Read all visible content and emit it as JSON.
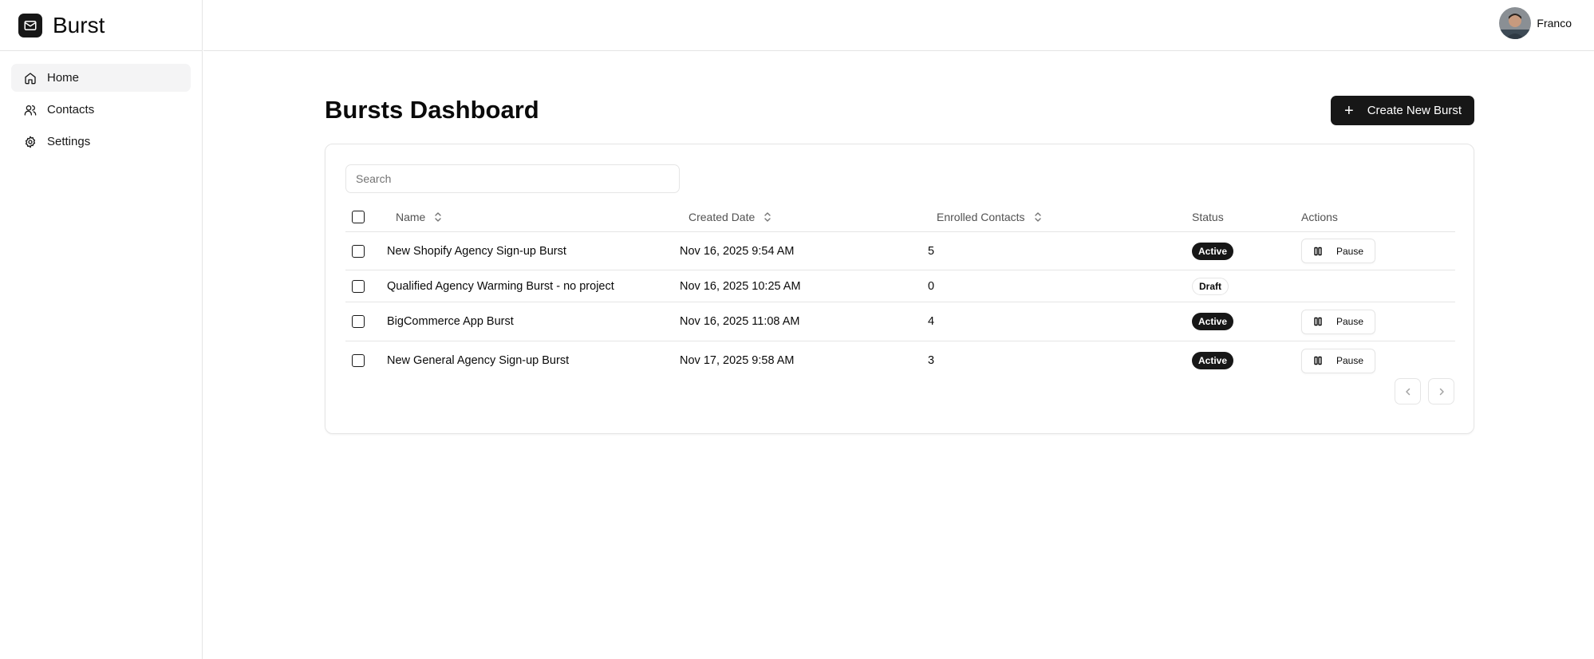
{
  "app": {
    "name": "Burst"
  },
  "sidebar": {
    "items": [
      {
        "label": "Home",
        "icon": "home-icon"
      },
      {
        "label": "Contacts",
        "icon": "users-icon"
      },
      {
        "label": "Settings",
        "icon": "gear-icon"
      }
    ]
  },
  "user": {
    "name": "Franco"
  },
  "main": {
    "title": "Bursts Dashboard",
    "create_label": "Create New Burst",
    "search_placeholder": "Search"
  },
  "table": {
    "columns": [
      "Name",
      "Created Date",
      "Enrolled Contacts",
      "Status",
      "Actions"
    ],
    "rows": [
      {
        "name": "New Shopify Agency Sign-up Burst",
        "created": "Nov 16, 2025 9:54 AM",
        "enrolled": "5",
        "status": "Active",
        "action": "Pause"
      },
      {
        "name": "Qualified Agency Warming Burst - no project",
        "created": "Nov 16, 2025 10:25 AM",
        "enrolled": "0",
        "status": "Draft",
        "action": ""
      },
      {
        "name": "BigCommerce App Burst",
        "created": "Nov 16, 2025 11:08 AM",
        "enrolled": "4",
        "status": "Active",
        "action": "Pause"
      },
      {
        "name": "New General Agency Sign-up Burst",
        "created": "Nov 17, 2025 9:58 AM",
        "enrolled": "3",
        "status": "Active",
        "action": "Pause"
      }
    ]
  },
  "colors": {
    "primary": "#171717",
    "border": "#e5e5e5",
    "muted_text": "#525252",
    "active_nav_bg": "#f4f4f5"
  }
}
